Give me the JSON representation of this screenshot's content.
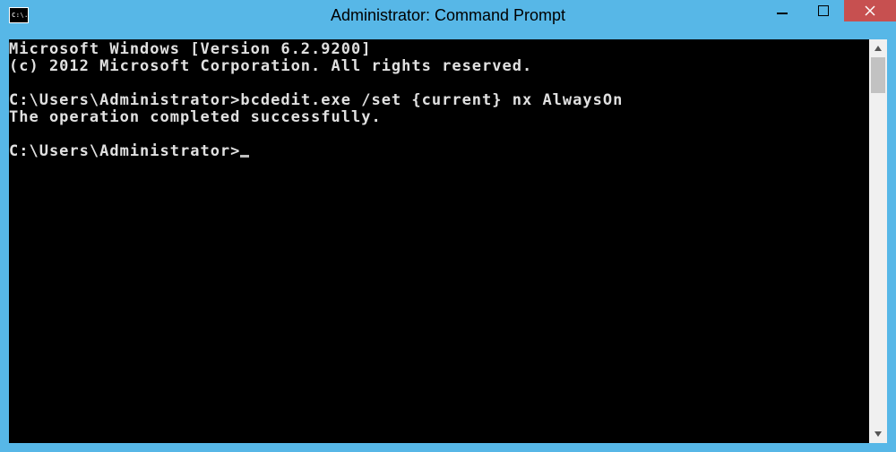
{
  "window": {
    "title": "Administrator: Command Prompt",
    "icon_text": "C:\\."
  },
  "terminal": {
    "line1": "Microsoft Windows [Version 6.2.9200]",
    "line2": "(c) 2012 Microsoft Corporation. All rights reserved.",
    "blank": "",
    "prompt1_path": "C:\\Users\\Administrator>",
    "command": "bcdedit.exe /set {current} nx AlwaysOn",
    "result": "The operation completed successfully.",
    "prompt2_path": "C:\\Users\\Administrator>"
  }
}
